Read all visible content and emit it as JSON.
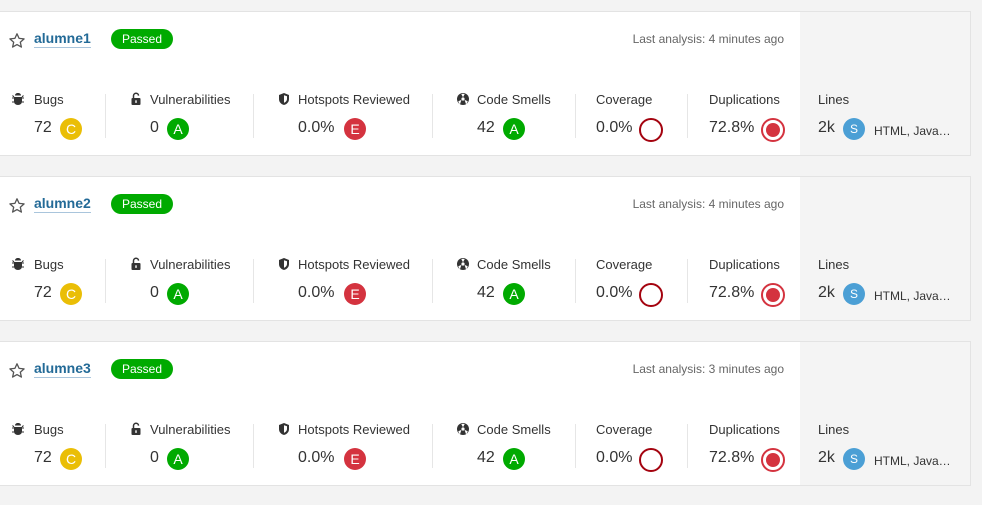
{
  "colors": {
    "passed": "#00aa00",
    "A": "#00aa00",
    "C": "#eabe06",
    "E": "#d4333f",
    "link": "#236a97"
  },
  "labels": {
    "bugs": "Bugs",
    "vulnerabilities": "Vulnerabilities",
    "hotspots": "Hotspots Reviewed",
    "code_smells": "Code Smells",
    "coverage": "Coverage",
    "duplications": "Duplications",
    "lines": "Lines"
  },
  "projects": [
    {
      "name": "alumne1",
      "quality_gate": "Passed",
      "last_analysis": "Last analysis: 4 minutes ago",
      "bugs": "72",
      "bugs_rating": "C",
      "vulnerabilities": "0",
      "vulnerabilities_rating": "A",
      "hotspots": "0.0%",
      "hotspots_rating": "E",
      "code_smells": "42",
      "code_smells_rating": "A",
      "coverage": "0.0%",
      "duplications": "72.8%",
      "lines": "2k",
      "size": "S",
      "languages": "HTML, Java…"
    },
    {
      "name": "alumne2",
      "quality_gate": "Passed",
      "last_analysis": "Last analysis: 4 minutes ago",
      "bugs": "72",
      "bugs_rating": "C",
      "vulnerabilities": "0",
      "vulnerabilities_rating": "A",
      "hotspots": "0.0%",
      "hotspots_rating": "E",
      "code_smells": "42",
      "code_smells_rating": "A",
      "coverage": "0.0%",
      "duplications": "72.8%",
      "lines": "2k",
      "size": "S",
      "languages": "HTML, Java…"
    },
    {
      "name": "alumne3",
      "quality_gate": "Passed",
      "last_analysis": "Last analysis: 3 minutes ago",
      "bugs": "72",
      "bugs_rating": "C",
      "vulnerabilities": "0",
      "vulnerabilities_rating": "A",
      "hotspots": "0.0%",
      "hotspots_rating": "E",
      "code_smells": "42",
      "code_smells_rating": "A",
      "coverage": "0.0%",
      "duplications": "72.8%",
      "lines": "2k",
      "size": "S",
      "languages": "HTML, Java…"
    }
  ]
}
